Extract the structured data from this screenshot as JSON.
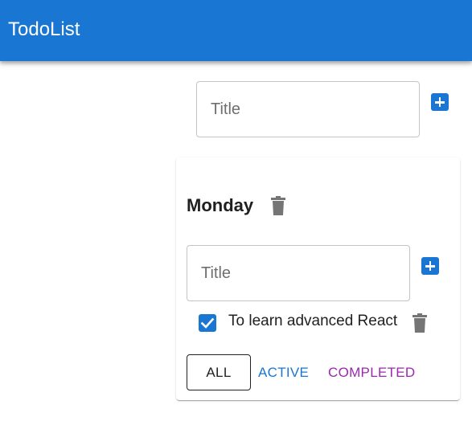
{
  "app": {
    "title": "TodoList"
  },
  "new_list": {
    "placeholder": "Title"
  },
  "lists": [
    {
      "title": "Monday",
      "new_task": {
        "placeholder": "Title"
      },
      "tasks": [
        {
          "title": "To learn advanced React",
          "done": true
        }
      ],
      "filters": {
        "all": "ALL",
        "active": "ACTIVE",
        "completed": "COMPLETED"
      }
    }
  ],
  "colors": {
    "primary": "#1976d2",
    "secondary": "#9c27b0",
    "icon_gray": "#757575"
  },
  "icons": {
    "add": "add-box-icon",
    "delete": "trash-icon",
    "checkbox": "checked-checkbox-icon"
  }
}
